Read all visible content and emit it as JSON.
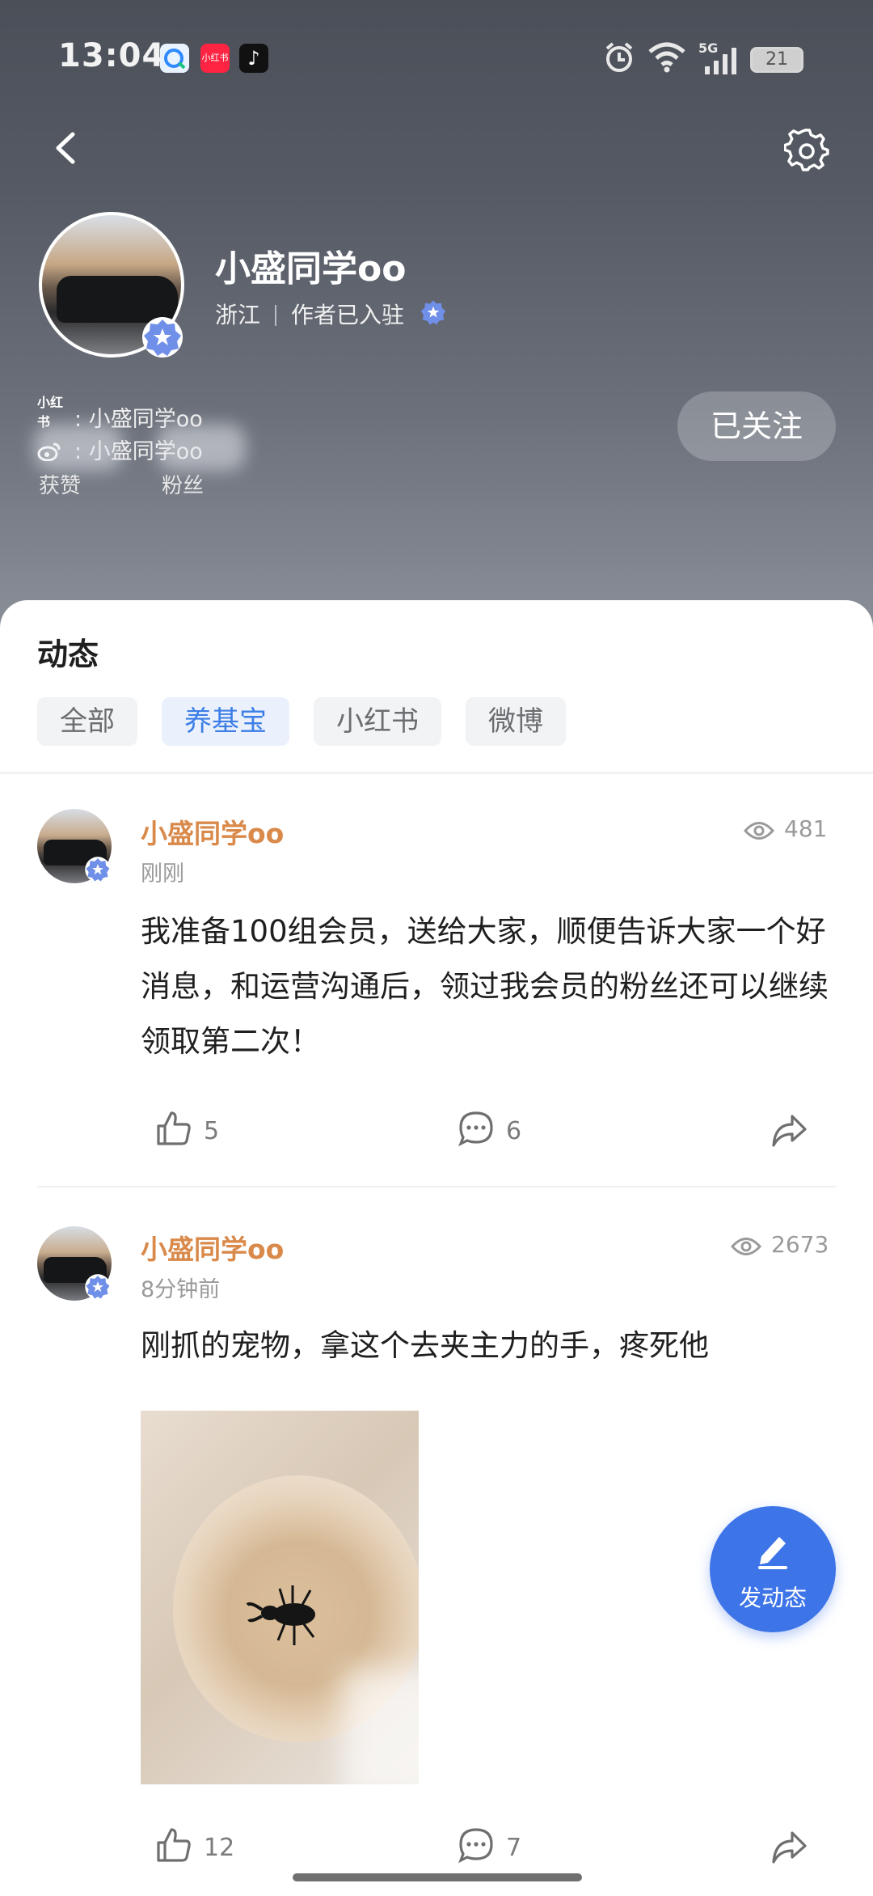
{
  "status_bar": {
    "time": "13:04",
    "apps": [
      "browser-app-icon",
      "xiaohongshu-app-icon",
      "tiktok-app-icon"
    ],
    "xiaohongshu_label": "小红书",
    "network": "5G",
    "battery": "21"
  },
  "nav": {
    "back_icon": "chevron-left-icon",
    "settings_icon": "gear-icon"
  },
  "profile": {
    "name": "小盛同学oo",
    "location": "浙江",
    "author_status": "作者已入驻",
    "platforms": [
      {
        "icon_label": "小红书",
        "name": "小盛同学oo"
      },
      {
        "icon_label": "",
        "name": "小盛同学oo"
      }
    ],
    "platform_sep": ":",
    "follow_label": "已关注",
    "stats": [
      {
        "label": "获赞"
      },
      {
        "label": "粉丝"
      }
    ]
  },
  "sheet": {
    "title": "动态",
    "filters": [
      "全部",
      "养基宝",
      "小红书",
      "微博"
    ],
    "active_filter": "养基宝"
  },
  "posts": [
    {
      "author": "小盛同学oo",
      "time": "刚刚",
      "views": "481",
      "text": "我准备100组会员，送给大家，顺便告诉大家一个好消息，和运营沟通后，领过我会员的粉丝还可以继续领取第二次！",
      "likes": "5",
      "comments": "6"
    },
    {
      "author": "小盛同学oo",
      "time": "8分钟前",
      "views": "2673",
      "text": "刚抓的宠物，拿这个去夹主力的手，疼死他",
      "likes": "12",
      "comments": "7"
    }
  ],
  "fab": {
    "label": "发动态"
  },
  "colors": {
    "accent": "#3d74e8",
    "author_name": "#d9894a",
    "active_chip_text": "#3d7ee6"
  }
}
